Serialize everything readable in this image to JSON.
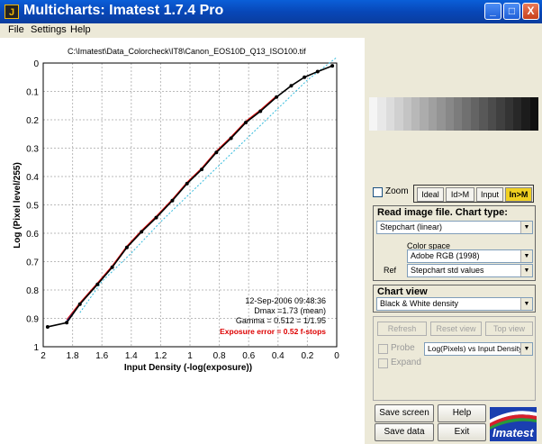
{
  "window": {
    "title": "Multicharts: Imatest 1.7.4  Pro",
    "app_icon": "J",
    "min_symbol": "_",
    "max_symbol": "□",
    "close_symbol": "X"
  },
  "menu": [
    "File",
    "Settings",
    "Help"
  ],
  "chart": {
    "title": "C:\\Imatest\\Data_Colorcheck\\IT8\\Canon_EOS10D_Q13_ISO100.tif",
    "annotations": {
      "date": "12-Sep-2006 09:48:36",
      "dmax": "Dmax =1.73 (mean)",
      "gamma": "Gamma = 0.512 = 1/1.95",
      "exposure_error": "Exposure error = 0.52 f-stops"
    }
  },
  "chart_data": {
    "type": "line",
    "xlabel": "Input Density (-log(exposure))",
    "ylabel": "Log (Pixel level/255)",
    "xlim": [
      2,
      0
    ],
    "ylim": [
      0,
      1
    ],
    "x_ticks": [
      "2",
      "1.8",
      "1.6",
      "1.4",
      "1.2",
      "1",
      "0.8",
      "0.6",
      "0.4",
      "0.2",
      "0"
    ],
    "y_ticks": [
      "0",
      "0.1",
      "0.2",
      "0.3",
      "0.4",
      "0.5",
      "0.6",
      "0.7",
      "0.8",
      "0.9",
      "1"
    ],
    "grid": true,
    "series": [
      {
        "color": "#000000",
        "x": [
          1.97,
          1.84,
          1.75,
          1.63,
          1.53,
          1.43,
          1.33,
          1.23,
          1.12,
          1.02,
          0.92,
          0.82,
          0.72,
          0.62,
          0.52,
          0.41,
          0.31,
          0.22,
          0.13,
          0.03
        ],
        "y": [
          0.93,
          0.915,
          0.85,
          0.78,
          0.72,
          0.65,
          0.595,
          0.545,
          0.485,
          0.425,
          0.375,
          0.315,
          0.265,
          0.21,
          0.17,
          0.12,
          0.08,
          0.05,
          0.03,
          0.01
        ]
      },
      {
        "color": "#dd0000",
        "x": [
          1.84,
          1.75,
          1.63,
          1.53,
          1.43,
          1.33,
          1.23,
          1.12,
          1.02,
          0.92,
          0.82,
          0.72,
          0.62,
          0.52,
          0.41
        ],
        "y": [
          0.905,
          0.845,
          0.775,
          0.715,
          0.645,
          0.59,
          0.54,
          0.48,
          0.42,
          0.37,
          0.31,
          0.26,
          0.205,
          0.165,
          0.115
        ]
      },
      {
        "color": "#00aa00",
        "x": [
          1.84,
          1.75,
          1.63,
          1.53,
          1.43,
          1.33,
          1.23,
          1.12,
          1.02,
          0.92,
          0.82,
          0.72,
          0.62,
          0.52,
          0.41
        ],
        "y": [
          0.91,
          0.85,
          0.78,
          0.72,
          0.65,
          0.595,
          0.545,
          0.485,
          0.425,
          0.375,
          0.315,
          0.265,
          0.21,
          0.17,
          0.12
        ]
      },
      {
        "color": "#2222cc",
        "x": [
          1.84,
          1.75,
          1.63,
          1.53,
          1.43,
          1.33,
          1.23,
          1.12,
          1.02,
          0.92,
          0.82,
          0.72,
          0.62,
          0.52,
          0.41
        ],
        "y": [
          0.91,
          0.85,
          0.78,
          0.72,
          0.65,
          0.595,
          0.545,
          0.485,
          0.425,
          0.375,
          0.315,
          0.265,
          0.21,
          0.17,
          0.12
        ]
      },
      {
        "color": "#33bbdd",
        "dashed": true,
        "x": [
          1.75,
          1.6,
          1.4,
          1.2,
          1.0,
          0.8,
          0.6,
          0.4,
          0.2,
          0.0
        ],
        "y": [
          0.88,
          0.77,
          0.67,
          0.56,
          0.46,
          0.36,
          0.26,
          0.16,
          0.06,
          -0.02
        ]
      }
    ]
  },
  "gray_patches": [
    "#f5f5f5",
    "#e8e8e8",
    "#dcdcdc",
    "#d0d0d0",
    "#c4c4c4",
    "#b8b8b8",
    "#acacac",
    "#a0a0a0",
    "#949494",
    "#888888",
    "#7c7c7c",
    "#707070",
    "#646464",
    "#585858",
    "#4c4c4c",
    "#404040",
    "#343434",
    "#282828",
    "#1c1c1c",
    "#101010"
  ],
  "controls": {
    "zoom_label": "Zoom",
    "modes": [
      "Ideal",
      "Id>M",
      "Input",
      "In>M"
    ],
    "read_panel": {
      "heading": "Read image file. Chart type:",
      "chart_type": "Stepchart (linear)",
      "color_space_label": "Color space",
      "color_space": "Adobe RGB (1998)",
      "ref_label": "Ref",
      "ref_value": "Stepchart std values"
    },
    "chart_view": {
      "heading": "Chart view",
      "value": "Black & White density"
    },
    "view_panel": {
      "refresh": "Refresh",
      "reset_view": "Reset view",
      "top_view": "Top view",
      "probe": "Probe",
      "probe_select": "Log(Pixels) vs Input Density",
      "expand": "Expand"
    },
    "buttons": {
      "save_screen": "Save screen",
      "help": "Help",
      "save_data": "Save data",
      "exit": "Exit"
    },
    "logo_text": "Imatest"
  }
}
